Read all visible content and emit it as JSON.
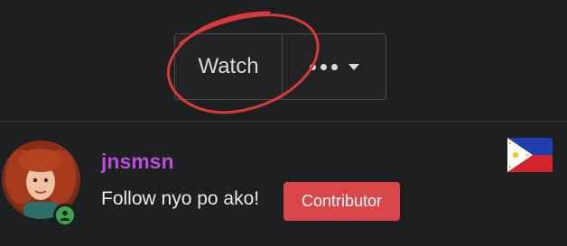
{
  "actions": {
    "watch_label": "Watch",
    "more_icon": "ellipsis-icon",
    "dropdown_icon": "caret-down-icon"
  },
  "annotation": {
    "color": "#d83a3a"
  },
  "user": {
    "username": "jnsmsn",
    "bio": "Follow nyo po ako!",
    "badge": "Contributor",
    "status": "online",
    "flag_icon": "philippines-flag-icon"
  },
  "colors": {
    "username": "#b84fd6",
    "badge_bg": "#d9474a",
    "online": "#3fa34d",
    "background": "#1e1f21"
  }
}
